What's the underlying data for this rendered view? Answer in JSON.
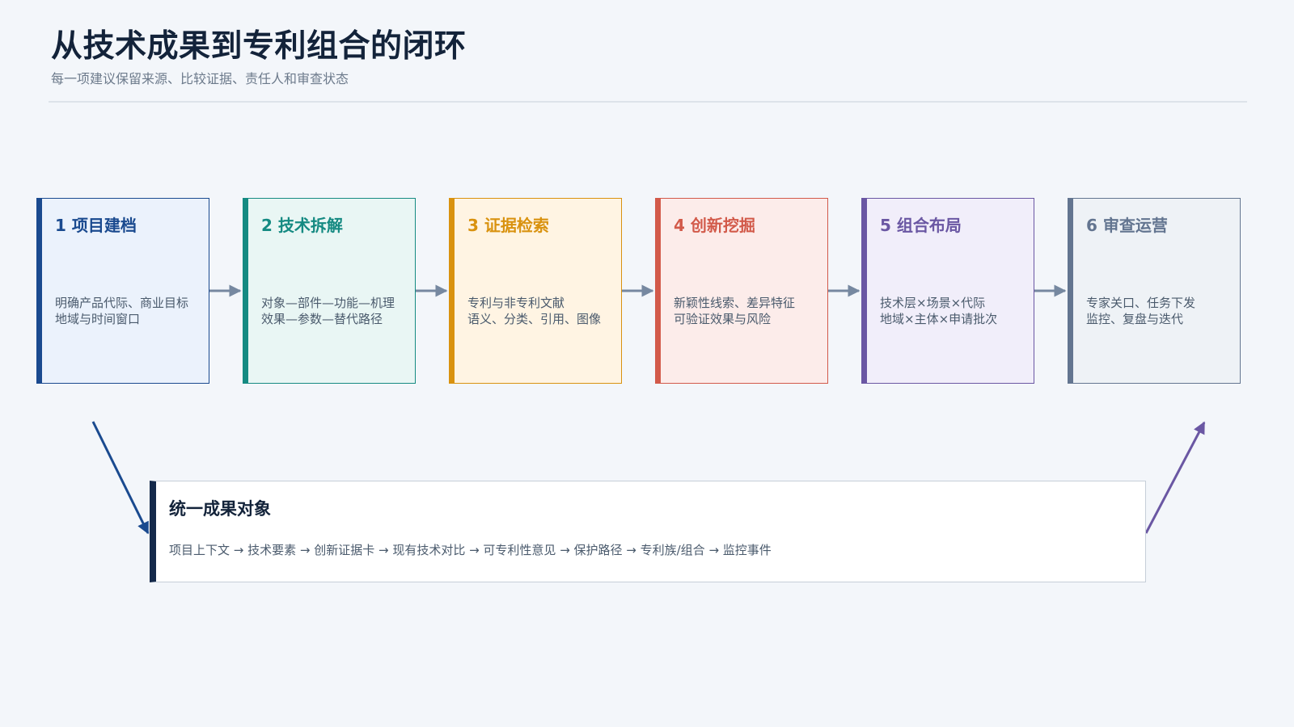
{
  "header": {
    "title": "从技术成果到专利组合的闭环",
    "subtitle": "每一项建议保留来源、比较证据、责任人和审查状态"
  },
  "steps": [
    {
      "title": "1 项目建档",
      "lines": [
        "明确产品代际、商业目标",
        "地域与时间窗口"
      ],
      "color": "#1a4a8f",
      "bg": "#ebf2fc"
    },
    {
      "title": "2 技术拆解",
      "lines": [
        "对象—部件—功能—机理",
        "效果—参数—替代路径"
      ],
      "color": "#158a82",
      "bg": "#e9f6f4"
    },
    {
      "title": "3 证据检索",
      "lines": [
        "专利与非专利文献",
        "语义、分类、引用、图像"
      ],
      "color": "#d9920f",
      "bg": "#fff4e3"
    },
    {
      "title": "4 创新挖掘",
      "lines": [
        "新颖性线索、差异特征",
        "可验证效果与风险"
      ],
      "color": "#d25a4a",
      "bg": "#fcecea"
    },
    {
      "title": "5 组合布局",
      "lines": [
        "技术层×场景×代际",
        "地域×主体×申请批次"
      ],
      "color": "#6a57a3",
      "bg": "#f1eefa"
    },
    {
      "title": "6 审查运营",
      "lines": [
        "专家关口、任务下发",
        "监控、复盘与迭代"
      ],
      "color": "#637590",
      "bg": "#eef2f6"
    }
  ],
  "unified": {
    "title": "统一成果对象",
    "flow": "项目上下文 → 技术要素 → 创新证据卡 → 现有技术对比 → 可专利性意见 → 保护路径 → 专利族/组合 → 监控事件"
  },
  "colors": {
    "arrow": "#7688a0",
    "left_arrow": "#1a4a8f",
    "right_arrow": "#6a57a3"
  }
}
